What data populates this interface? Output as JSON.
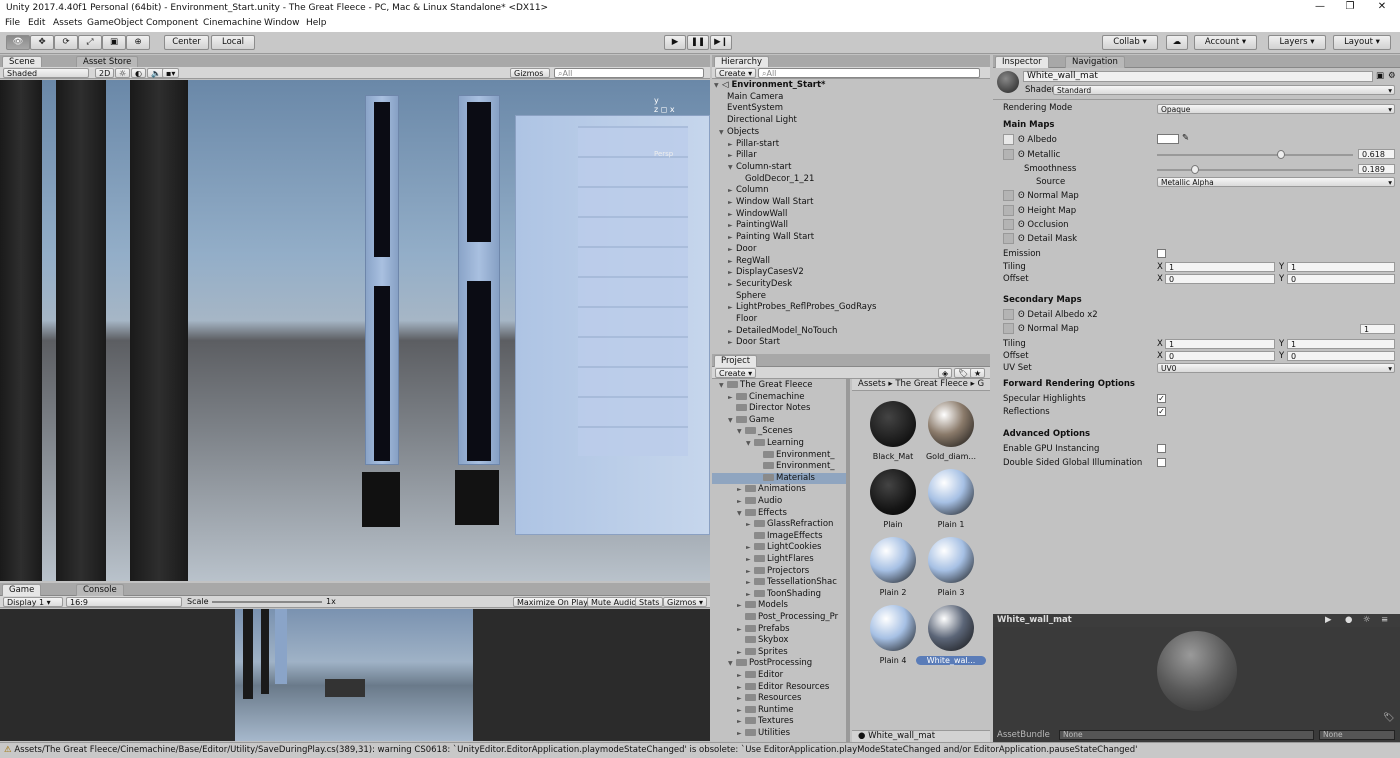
{
  "window": {
    "title": "Unity 2017.4.40f1 Personal (64bit) - Environment_Start.unity - The Great Fleece - PC, Mac & Linux Standalone* <DX11>"
  },
  "menu": [
    "File",
    "Edit",
    "Assets",
    "GameObject",
    "Component",
    "Cinemachine",
    "Window",
    "Help"
  ],
  "toolbar": {
    "center": "Center",
    "local": "Local",
    "collab": "Collab ▾",
    "account": "Account",
    "layers": "Layers",
    "layout": "Layout"
  },
  "scene": {
    "tabs": [
      "Scene",
      "Asset Store"
    ],
    "shaded": "Shaded",
    "mode2d": "2D",
    "gizmos": "Gizmos",
    "search_placeholder": "All",
    "persp": "Persp"
  },
  "game": {
    "tabs": [
      "Game",
      "Console"
    ],
    "display": "Display 1",
    "aspect": "16:9",
    "scale_label": "Scale",
    "scale_value": "1x",
    "maximize": "Maximize On Play",
    "mute": "Mute Audio",
    "stats": "Stats",
    "gizmos": "Gizmos"
  },
  "hierarchy": {
    "tab": "Hierarchy",
    "create": "Create",
    "search_placeholder": "All",
    "scene_name": "Environment_Start*",
    "items": [
      {
        "label": "Main Camera",
        "indent": 1,
        "arrow": ""
      },
      {
        "label": "EventSystem",
        "indent": 1,
        "arrow": ""
      },
      {
        "label": "Directional Light",
        "indent": 1,
        "arrow": ""
      },
      {
        "label": "Objects",
        "indent": 1,
        "arrow": "▼"
      },
      {
        "label": "Pillar-start",
        "indent": 2,
        "arrow": "►"
      },
      {
        "label": "Pillar",
        "indent": 2,
        "arrow": "►"
      },
      {
        "label": "Column-start",
        "indent": 2,
        "arrow": "▼"
      },
      {
        "label": "GoldDecor_1_21",
        "indent": 3,
        "arrow": ""
      },
      {
        "label": "Column",
        "indent": 2,
        "arrow": "►"
      },
      {
        "label": "Window Wall Start",
        "indent": 2,
        "arrow": "►"
      },
      {
        "label": "WindowWall",
        "indent": 2,
        "arrow": "►"
      },
      {
        "label": "PaintingWall",
        "indent": 2,
        "arrow": "►"
      },
      {
        "label": "Painting Wall Start",
        "indent": 2,
        "arrow": "►"
      },
      {
        "label": "Door",
        "indent": 2,
        "arrow": "►"
      },
      {
        "label": "RegWall",
        "indent": 2,
        "arrow": "►"
      },
      {
        "label": "DisplayCasesV2",
        "indent": 2,
        "arrow": "►"
      },
      {
        "label": "SecurityDesk",
        "indent": 2,
        "arrow": "►"
      },
      {
        "label": "Sphere",
        "indent": 2,
        "arrow": ""
      },
      {
        "label": "LightProbes_ReflProbes_GodRays",
        "indent": 2,
        "arrow": "►"
      },
      {
        "label": "Floor",
        "indent": 2,
        "arrow": ""
      },
      {
        "label": "DetailedModel_NoTouch",
        "indent": 2,
        "arrow": "►"
      },
      {
        "label": "Door Start",
        "indent": 2,
        "arrow": "►"
      }
    ]
  },
  "project": {
    "tab": "Project",
    "create": "Create",
    "breadcrumb": [
      "Assets",
      "The Great Fleece",
      "G"
    ],
    "tree": [
      {
        "label": "The Great Fleece",
        "indent": 1,
        "arrow": "▼"
      },
      {
        "label": "Cinemachine",
        "indent": 2,
        "arrow": "►"
      },
      {
        "label": "Director Notes",
        "indent": 2,
        "arrow": ""
      },
      {
        "label": "Game",
        "indent": 2,
        "arrow": "▼"
      },
      {
        "label": "_Scenes",
        "indent": 3,
        "arrow": "▼"
      },
      {
        "label": "Learning",
        "indent": 4,
        "arrow": "▼"
      },
      {
        "label": "Environment_",
        "indent": 5,
        "arrow": ""
      },
      {
        "label": "Environment_",
        "indent": 5,
        "arrow": ""
      },
      {
        "label": "Materials",
        "indent": 5,
        "arrow": "",
        "selected": true
      },
      {
        "label": "Animations",
        "indent": 3,
        "arrow": "►"
      },
      {
        "label": "Audio",
        "indent": 3,
        "arrow": "►"
      },
      {
        "label": "Effects",
        "indent": 3,
        "arrow": "▼"
      },
      {
        "label": "GlassRefraction",
        "indent": 4,
        "arrow": "►"
      },
      {
        "label": "ImageEffects",
        "indent": 4,
        "arrow": ""
      },
      {
        "label": "LightCookies",
        "indent": 4,
        "arrow": "►"
      },
      {
        "label": "LightFlares",
        "indent": 4,
        "arrow": "►"
      },
      {
        "label": "Projectors",
        "indent": 4,
        "arrow": "►"
      },
      {
        "label": "TessellationShac",
        "indent": 4,
        "arrow": "►"
      },
      {
        "label": "ToonShading",
        "indent": 4,
        "arrow": "►"
      },
      {
        "label": "Models",
        "indent": 3,
        "arrow": "►"
      },
      {
        "label": "Post_Processing_Pr",
        "indent": 3,
        "arrow": ""
      },
      {
        "label": "Prefabs",
        "indent": 3,
        "arrow": "►"
      },
      {
        "label": "Skybox",
        "indent": 3,
        "arrow": ""
      },
      {
        "label": "Sprites",
        "indent": 3,
        "arrow": "►"
      },
      {
        "label": "PostProcessing",
        "indent": 2,
        "arrow": "▼"
      },
      {
        "label": "Editor",
        "indent": 3,
        "arrow": "►"
      },
      {
        "label": "Editor Resources",
        "indent": 3,
        "arrow": "►"
      },
      {
        "label": "Resources",
        "indent": 3,
        "arrow": "►"
      },
      {
        "label": "Runtime",
        "indent": 3,
        "arrow": "►"
      },
      {
        "label": "Textures",
        "indent": 3,
        "arrow": "►"
      },
      {
        "label": "Utilities",
        "indent": 3,
        "arrow": "►"
      }
    ],
    "materials": [
      {
        "label": "Black_Mat",
        "color": "#1c1c1c"
      },
      {
        "label": "Gold_diam...",
        "color": "#8a7a6a"
      },
      {
        "label": "Plain",
        "color": "#151515"
      },
      {
        "label": "Plain 1",
        "color": "#a6c0e4"
      },
      {
        "label": "Plain 2",
        "color": "#a6c0e4"
      },
      {
        "label": "Plain 3",
        "color": "#a6c0e4"
      },
      {
        "label": "Plain 4",
        "color": "#a6c0e4"
      },
      {
        "label": "White_wal...",
        "color": "#5c6678",
        "selected": true
      }
    ],
    "footer": "White_wall_mat"
  },
  "inspector": {
    "tabs": [
      "Inspector",
      "Navigation"
    ],
    "material_name": "White_wall_mat",
    "shader_label": "Shader",
    "shader": "Standard",
    "rendering_mode_label": "Rendering Mode",
    "rendering_mode": "Opaque",
    "main_maps": "Main Maps",
    "albedo": "Albedo",
    "metallic": "Metallic",
    "metallic_value": "0.618",
    "smoothness": "Smoothness",
    "smoothness_value": "0.189",
    "source": "Source",
    "source_value": "Metallic Alpha",
    "normal_map": "Normal Map",
    "height_map": "Height Map",
    "occlusion": "Occlusion",
    "detail_mask": "Detail Mask",
    "emission": "Emission",
    "tiling": "Tiling",
    "offset": "Offset",
    "tiling_x": "1",
    "tiling_y": "1",
    "offset_x": "0",
    "offset_y": "0",
    "secondary_maps": "Secondary Maps",
    "detail_albedo": "Detail Albedo x2",
    "normal_map2": "Normal Map",
    "normal_scale": "1",
    "tiling2_x": "1",
    "tiling2_y": "1",
    "offset2_x": "0",
    "offset2_y": "0",
    "uv_set": "UV Set",
    "uv_set_value": "UV0",
    "forward": "Forward Rendering Options",
    "specular": "Specular Highlights",
    "reflections": "Reflections",
    "advanced": "Advanced Options",
    "gpu_instancing": "Enable GPU Instancing",
    "double_sided": "Double Sided Global Illumination",
    "preview_title": "White_wall_mat",
    "assetbundle": "AssetBundle",
    "none1": "None",
    "none2": "None",
    "x": "X",
    "y": "Y"
  },
  "status": {
    "message": "Assets/The Great Fleece/Cinemachine/Base/Editor/Utility/SaveDuringPlay.cs(389,31): warning CS0618: `UnityEditor.EditorApplication.playmodeStateChanged' is obsolete: `Use EditorApplication.playModeStateChanged and/or EditorApplication.pauseStateChanged'"
  }
}
